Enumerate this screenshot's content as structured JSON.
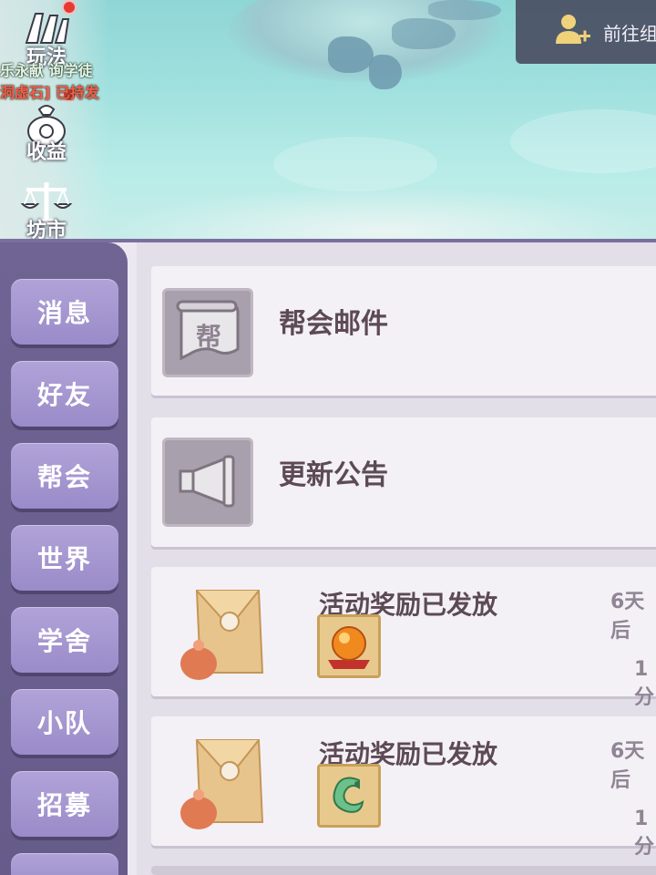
{
  "scene": {
    "side_icons": [
      {
        "label": "玩法"
      },
      {
        "label": "收益"
      },
      {
        "label": "坊市"
      }
    ],
    "scroll_line1": "乐永献 询学徒",
    "scroll_line2": "洞虚石] 已持发",
    "goto_team_label": "前往组"
  },
  "sidebar": {
    "tabs": [
      {
        "label": "消息"
      },
      {
        "label": "好友"
      },
      {
        "label": "帮会"
      },
      {
        "label": "世界"
      },
      {
        "label": "学舍"
      },
      {
        "label": "小队"
      },
      {
        "label": "招募"
      }
    ]
  },
  "list": {
    "guild_mail": {
      "title": "帮会邮件",
      "icon_char": "帮"
    },
    "update_notice": {
      "title": "更新公告"
    },
    "mails": [
      {
        "title": "活动奖励已发放",
        "time_top": "6天后",
        "time_bottom": "1分",
        "reward": "orange-orb-icon"
      },
      {
        "title": "活动奖励已发放",
        "time_top": "6天后",
        "time_bottom": "1分",
        "reward": "jade-dragon-icon"
      }
    ]
  },
  "colors": {
    "sidebar": "#6f6493",
    "tab": "#a697d1",
    "item_bg": "#f4f1f6",
    "title_text": "#5d4a55"
  }
}
